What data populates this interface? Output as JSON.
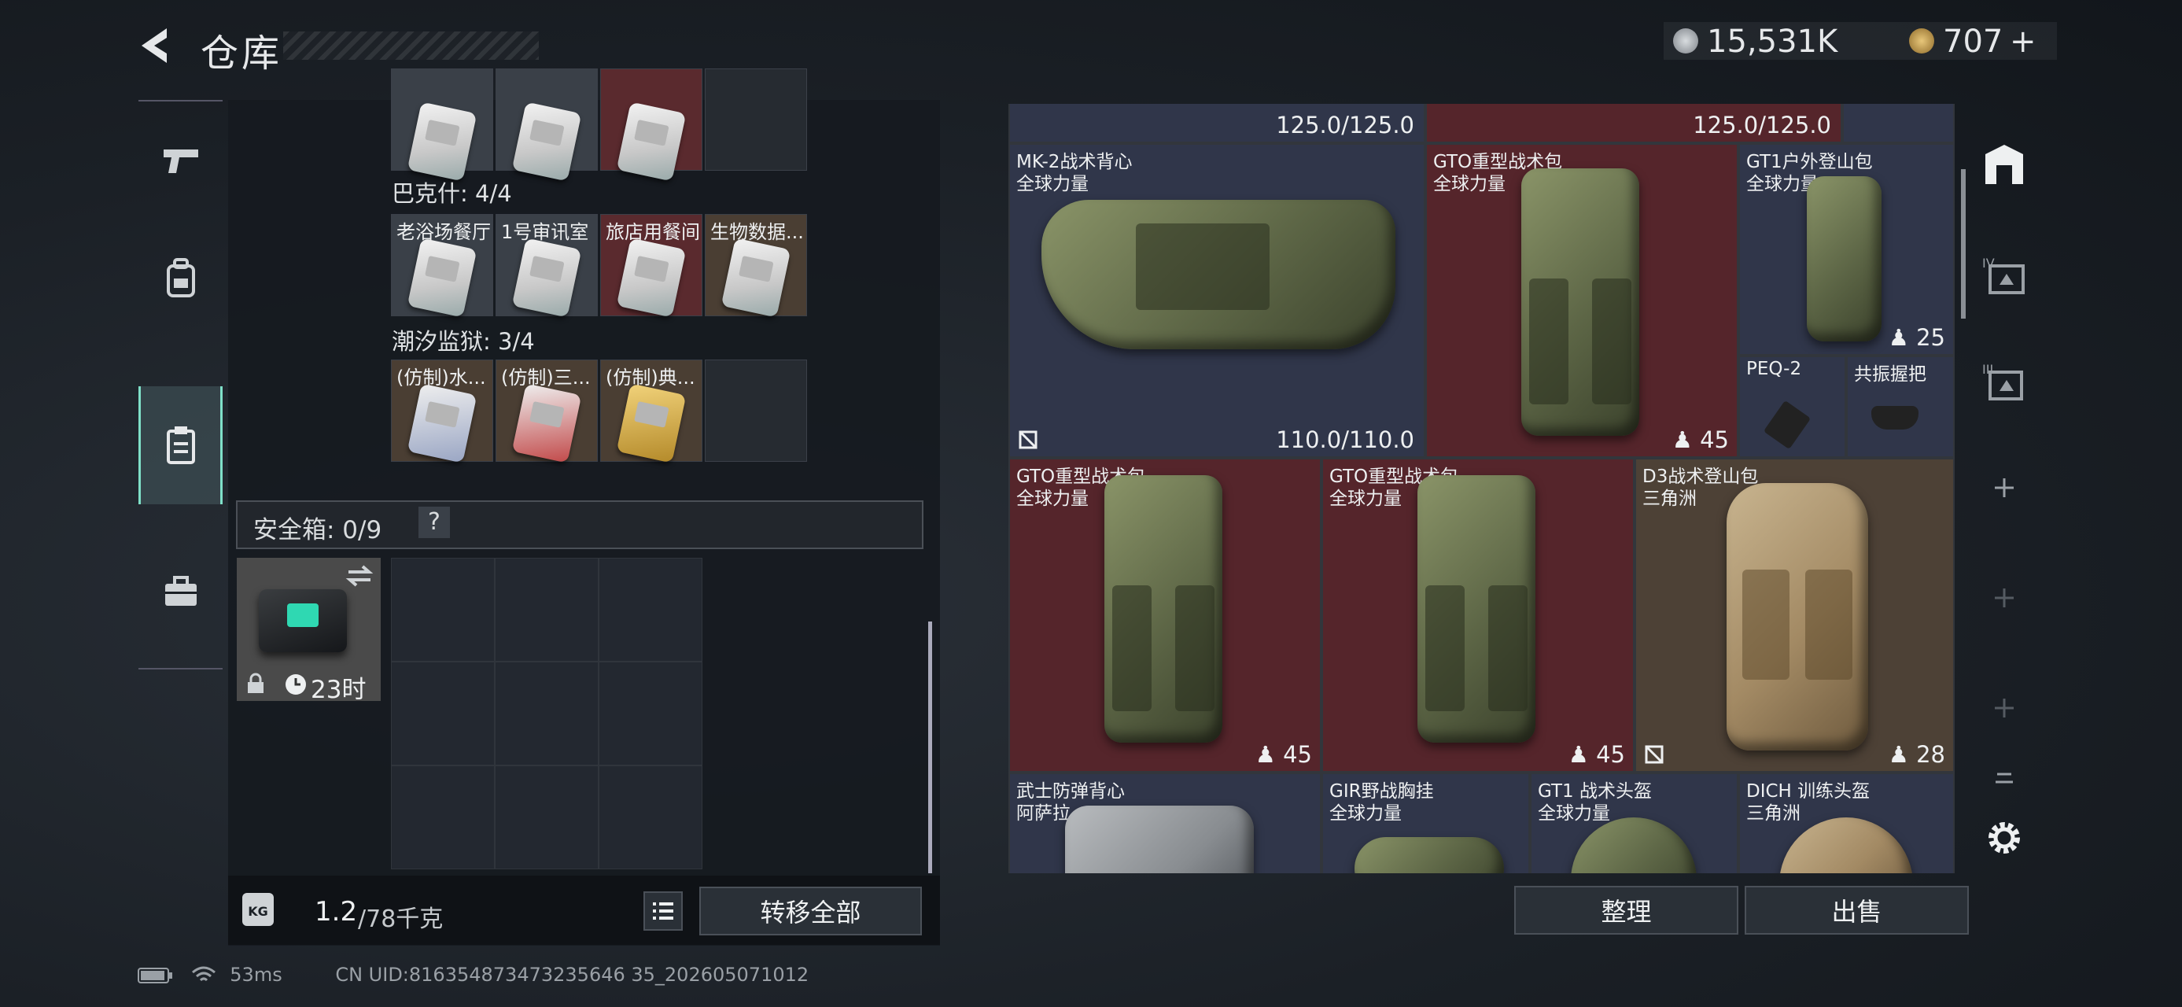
{
  "header": {
    "title": "仓库",
    "currency_primary": "15,531K",
    "currency_secondary": "707",
    "plus": "+"
  },
  "left_nav": {
    "items": [
      {
        "icon": "pistol-icon"
      },
      {
        "icon": "backpack-icon"
      },
      {
        "icon": "clipboard-icon",
        "active": true
      },
      {
        "icon": "toolbox-icon"
      }
    ]
  },
  "keys": {
    "groups": [
      {
        "title": "巴克什: 4/4",
        "items": [
          "老浴场餐厅",
          "1号审讯室",
          "旅店用餐间",
          "生物数据..."
        ]
      },
      {
        "title": "潮汐监狱: 3/4",
        "items": [
          "(仿制)水...",
          "(仿制)三...",
          "(仿制)典..."
        ]
      }
    ]
  },
  "safe": {
    "label": "安全箱: 0/9",
    "help": "?",
    "timer": "23时"
  },
  "weight": {
    "current": "1.2",
    "max": "/78千克",
    "badge": "KG"
  },
  "buttons": {
    "transfer_all": "转移全部",
    "organize": "整理",
    "sell": "出售"
  },
  "stash": {
    "top_durability": [
      "125.0/125.0",
      "125.0/125.0"
    ],
    "items": [
      {
        "name": "MK-2战术背心",
        "sub": "全球力量",
        "durability": "110.0/110.0"
      },
      {
        "name": "GTO重型战术包",
        "sub": "全球力量",
        "count": "45"
      },
      {
        "name": "GT1户外登山包",
        "sub": "全球力量",
        "count": "25"
      },
      {
        "name": "PEQ-2",
        "sub": ""
      },
      {
        "name": "共振握把",
        "sub": ""
      },
      {
        "name": "GTO重型战术包",
        "sub": "全球力量",
        "count": "45"
      },
      {
        "name": "GTO重型战术包",
        "sub": "全球力量",
        "count": "45"
      },
      {
        "name": "D3战术登山包",
        "sub": "三角洲",
        "count": "28"
      },
      {
        "name": "武士防弹背心",
        "sub": "阿萨拉"
      },
      {
        "name": "GIR野战胸挂",
        "sub": "全球力量"
      },
      {
        "name": "GT1 战术头盔",
        "sub": "全球力量"
      },
      {
        "name": "DICH 训练头盔",
        "sub": "三角洲"
      }
    ]
  },
  "status": {
    "ping": "53ms",
    "uid": "CN UID:816354873473235646 35_202605071012"
  },
  "colors": {
    "accent": "#7fe0c8",
    "red_slot": "#55252b",
    "navy_slot": "#30364a",
    "brown_slot": "#4d4136"
  }
}
